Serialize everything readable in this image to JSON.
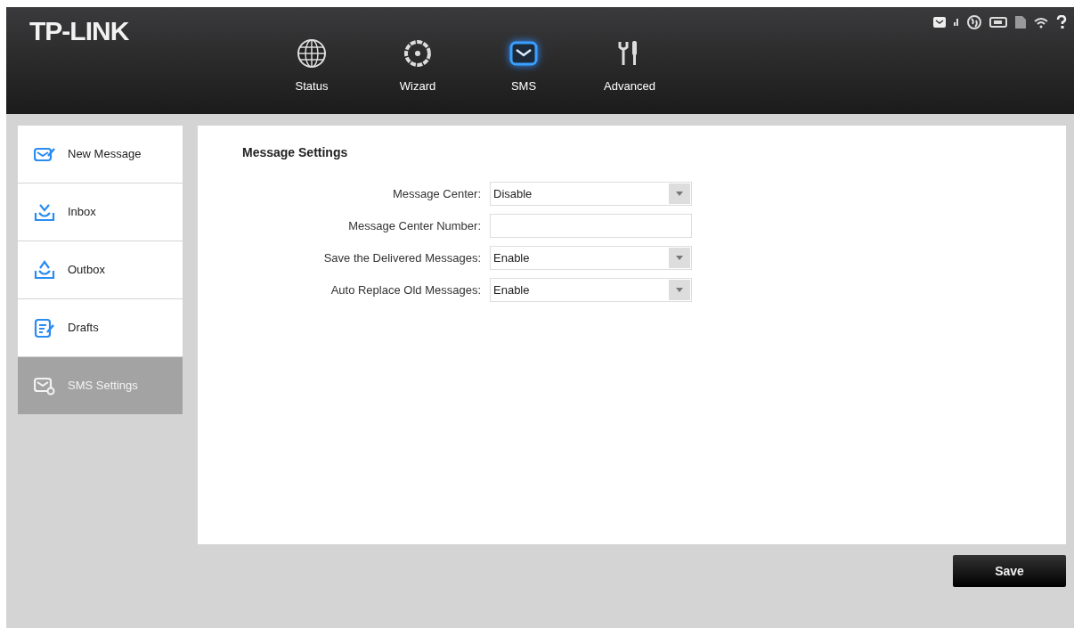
{
  "header": {
    "logo": "TP-LINK",
    "nav": [
      {
        "label": "Status",
        "selected": false
      },
      {
        "label": "Wizard",
        "selected": false
      },
      {
        "label": "SMS",
        "selected": true
      },
      {
        "label": "Advanced",
        "selected": false
      }
    ]
  },
  "sidebar": {
    "items": [
      {
        "label": "New Message",
        "selected": false
      },
      {
        "label": "Inbox",
        "selected": false
      },
      {
        "label": "Outbox",
        "selected": false
      },
      {
        "label": "Drafts",
        "selected": false
      },
      {
        "label": "SMS Settings",
        "selected": true
      }
    ]
  },
  "content": {
    "title": "Message Settings",
    "fields": [
      {
        "label": "Message Center:",
        "kind": "select",
        "value": "Disable"
      },
      {
        "label": "Message Center Number:",
        "kind": "text"
      },
      {
        "label": "Save the Delivered Messages:",
        "kind": "select",
        "value": "Enable"
      },
      {
        "label": "Auto Replace Old Messages:",
        "kind": "select",
        "value": "Enable"
      }
    ]
  },
  "save_button": "Save"
}
